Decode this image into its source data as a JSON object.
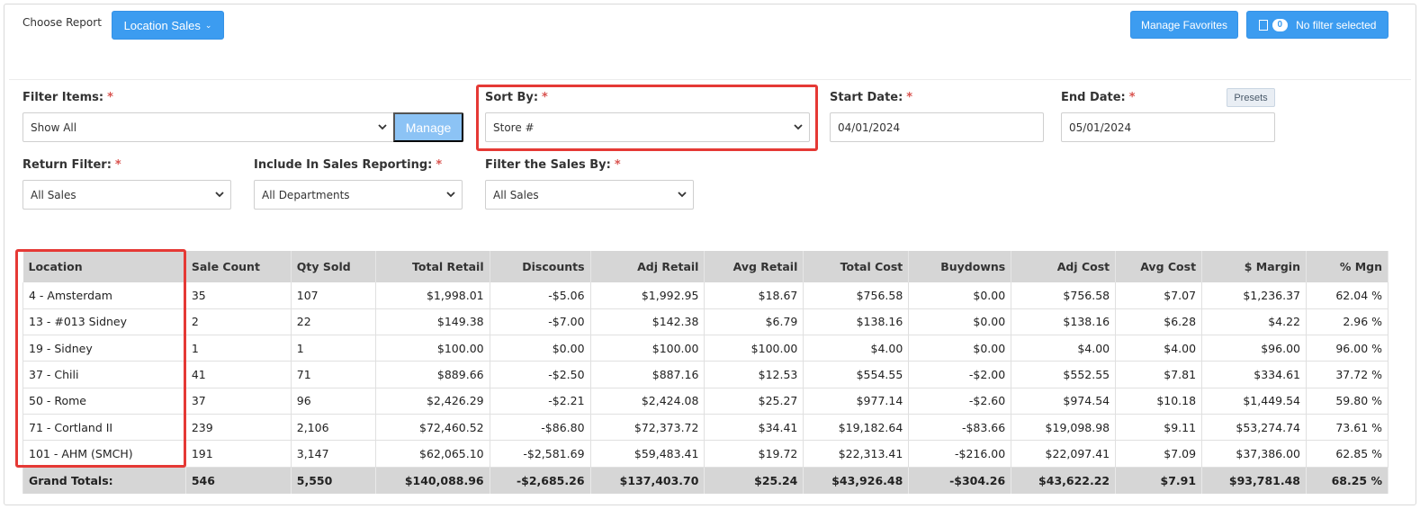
{
  "header": {
    "choose_report_label": "Choose Report",
    "report_button_label": "Location Sales",
    "manage_favorites_label": "Manage Favorites",
    "filter_count": "0",
    "filter_status_label": "No filter selected"
  },
  "filters": {
    "filter_items": {
      "label": "Filter Items:",
      "value": "Show All",
      "manage_label": "Manage"
    },
    "sort_by": {
      "label": "Sort By:",
      "value": "Store #"
    },
    "start_date": {
      "label": "Start Date:",
      "value": "04/01/2024"
    },
    "end_date": {
      "label": "End Date:",
      "value": "05/01/2024",
      "presets_label": "Presets"
    },
    "return_filter": {
      "label": "Return Filter:",
      "value": "All Sales"
    },
    "include_in_sales": {
      "label": "Include In Sales Reporting:",
      "value": "All Departments"
    },
    "filter_sales_by": {
      "label": "Filter the Sales By:",
      "value": "All Sales"
    },
    "required_mark": "*"
  },
  "table": {
    "columns": [
      "Location",
      "Sale Count",
      "Qty Sold",
      "Total Retail",
      "Discounts",
      "Adj Retail",
      "Avg Retail",
      "Total Cost",
      "Buydowns",
      "Adj Cost",
      "Avg Cost",
      "$ Margin",
      "% Mgn"
    ],
    "rows": [
      [
        "4 - Amsterdam",
        "35",
        "107",
        "$1,998.01",
        "-$5.06",
        "$1,992.95",
        "$18.67",
        "$756.58",
        "$0.00",
        "$756.58",
        "$7.07",
        "$1,236.37",
        "62.04 %"
      ],
      [
        "13 - #013 Sidney",
        "2",
        "22",
        "$149.38",
        "-$7.00",
        "$142.38",
        "$6.79",
        "$138.16",
        "$0.00",
        "$138.16",
        "$6.28",
        "$4.22",
        "2.96 %"
      ],
      [
        "19 - Sidney",
        "1",
        "1",
        "$100.00",
        "$0.00",
        "$100.00",
        "$100.00",
        "$4.00",
        "$0.00",
        "$4.00",
        "$4.00",
        "$96.00",
        "96.00 %"
      ],
      [
        "37 - Chili",
        "41",
        "71",
        "$889.66",
        "-$2.50",
        "$887.16",
        "$12.53",
        "$554.55",
        "-$2.00",
        "$552.55",
        "$7.81",
        "$334.61",
        "37.72 %"
      ],
      [
        "50 - Rome",
        "37",
        "96",
        "$2,426.29",
        "-$2.21",
        "$2,424.08",
        "$25.27",
        "$977.14",
        "-$2.60",
        "$974.54",
        "$10.18",
        "$1,449.54",
        "59.80 %"
      ],
      [
        "71 - Cortland II",
        "239",
        "2,106",
        "$72,460.52",
        "-$86.80",
        "$72,373.72",
        "$34.41",
        "$19,182.64",
        "-$83.66",
        "$19,098.98",
        "$9.11",
        "$53,274.74",
        "73.61 %"
      ],
      [
        "101 - AHM (SMCH)",
        "191",
        "3,147",
        "$62,065.10",
        "-$2,581.69",
        "$59,483.41",
        "$19.72",
        "$22,313.41",
        "-$216.00",
        "$22,097.41",
        "$7.09",
        "$37,386.00",
        "62.85 %"
      ]
    ],
    "totals": [
      "Grand Totals:",
      "546",
      "5,550",
      "$140,088.96",
      "-$2,685.26",
      "$137,403.70",
      "$25.24",
      "$43,926.48",
      "-$304.26",
      "$43,622.22",
      "$7.91",
      "$93,781.48",
      "68.25 %"
    ]
  },
  "colors": {
    "primary": "#3c9cf0",
    "manage_disabled": "#8cc3f5",
    "highlight": "#e53935",
    "required": "#d9534f",
    "table_header": "#d6d6d6"
  }
}
